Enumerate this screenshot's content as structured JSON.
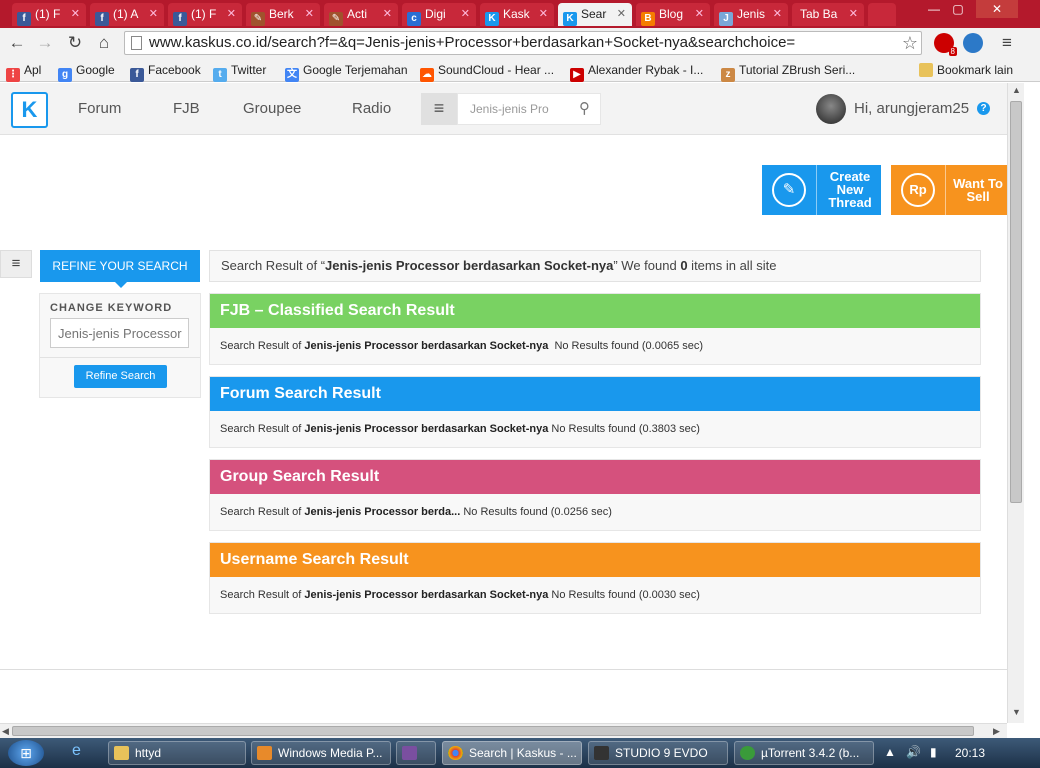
{
  "tabs": [
    {
      "title": "(1) F",
      "icon": "facebook-icon",
      "color": "#3b5998"
    },
    {
      "title": "(1) A",
      "icon": "facebook-icon",
      "color": "#3b5998"
    },
    {
      "title": "(1) F",
      "icon": "facebook-icon",
      "color": "#3b5998"
    },
    {
      "title": "Berk",
      "icon": "pen-icon",
      "color": "#a0522d"
    },
    {
      "title": "Acti",
      "icon": "pen-icon",
      "color": "#a0522d"
    },
    {
      "title": "Digi",
      "icon": "cg-icon",
      "color": "#2a6ed3"
    },
    {
      "title": "Kask",
      "icon": "kaskus-icon",
      "color": "#1998ed"
    },
    {
      "title": "Sear",
      "icon": "kaskus-icon",
      "color": "#1998ed",
      "active": true
    },
    {
      "title": "Blog",
      "icon": "blogger-icon",
      "color": "#f57d00"
    },
    {
      "title": "Jenis",
      "icon": "page-icon",
      "color": "#7aa7d8"
    },
    {
      "title": "Tab Ba",
      "icon": "",
      "color": ""
    }
  ],
  "browser": {
    "url": "www.kaskus.co.id/search?f=&q=Jenis-jenis+Processor+berdasarkan+Socket-nya&searchchoice=",
    "ext_badge": "8"
  },
  "bookmarks": [
    {
      "label": "Apl",
      "icon": "apps-icon",
      "color": "#e44"
    },
    {
      "label": "Google",
      "icon": "google-icon",
      "color": "#4285f4"
    },
    {
      "label": "Facebook",
      "icon": "facebook-icon",
      "color": "#3b5998"
    },
    {
      "label": "Twitter",
      "icon": "twitter-icon",
      "color": "#55acee"
    },
    {
      "label": "Google Terjemahan",
      "icon": "translate-icon",
      "color": "#4285f4"
    },
    {
      "label": "SoundCloud - Hear ...",
      "icon": "soundcloud-icon",
      "color": "#f50"
    },
    {
      "label": "Alexander Rybak - I...",
      "icon": "youtube-icon",
      "color": "#c00"
    },
    {
      "label": "Tutorial ZBrush Seri...",
      "icon": "zbrush-icon",
      "color": "#c84"
    },
    {
      "label": "Bookmark lain",
      "icon": "folder-icon",
      "color": "#e8c25a"
    }
  ],
  "header": {
    "nav": [
      "Forum",
      "FJB",
      "Groupee",
      "Radio"
    ],
    "search_value": "Jenis-jenis Pro",
    "greeting": "Hi, arungjeram25"
  },
  "actions": {
    "create_thread": [
      "Create",
      "New",
      "Thread"
    ],
    "want_to_sell": [
      "Want To",
      "Sell"
    ],
    "create_color": "#1998ed",
    "sell_color": "#f7931e"
  },
  "refine": {
    "tab_label": "REFINE YOUR SEARCH",
    "change_keyword": "CHANGE KEYWORD",
    "keyword_placeholder": "Jenis-jenis Processor",
    "button": "Refine Search"
  },
  "summary": {
    "prefix": "Search Result of “",
    "query": "Jenis-jenis Processor berdasarkan Socket-nya",
    "middle": "” We found ",
    "count": "0",
    "suffix": " items in all site"
  },
  "sections": [
    {
      "title": "FJB – Classified Search Result",
      "color": "#79d262",
      "prefix": "Search Result of ",
      "query": "Jenis-jenis Processor berdasarkan Socket-nya",
      "status": "  No Results found (0.0065 sec)"
    },
    {
      "title": "Forum Search Result",
      "color": "#1998ed",
      "prefix": "Search Result of ",
      "query": "Jenis-jenis Processor berdasarkan Socket-nya",
      "status": " No Results found (0.3803 sec)"
    },
    {
      "title": "Group Search Result",
      "color": "#d5517d",
      "prefix": "Search Result of ",
      "query": "Jenis-jenis Processor berda...",
      "status": " No Results found (0.0256 sec)"
    },
    {
      "title": "Username Search Result",
      "color": "#f7931e",
      "prefix": "Search Result of ",
      "query": "Jenis-jenis Processor berdasarkan Socket-nya",
      "status": " No Results found (0.0030 sec)"
    }
  ],
  "taskbar": {
    "items": [
      {
        "label": "httyd",
        "icon": "folder-icon"
      },
      {
        "label": "Windows Media P...",
        "icon": "media-player-icon"
      },
      {
        "label": "",
        "icon": "app-icon"
      },
      {
        "label": "Search | Kaskus - ...",
        "icon": "chrome-icon",
        "active": true
      },
      {
        "label": "STUDIO 9 EVDO",
        "icon": "modem-icon"
      },
      {
        "label": "µTorrent 3.4.2  (b...",
        "icon": "utorrent-icon"
      }
    ],
    "clock": "20:13"
  }
}
